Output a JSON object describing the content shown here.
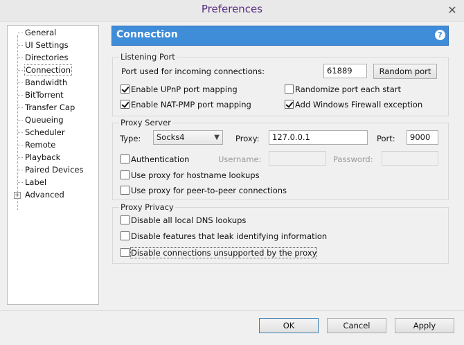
{
  "window": {
    "title": "Preferences",
    "close_glyph": "✕"
  },
  "sidebar": {
    "items": [
      {
        "label": "General"
      },
      {
        "label": "UI Settings"
      },
      {
        "label": "Directories"
      },
      {
        "label": "Connection"
      },
      {
        "label": "Bandwidth"
      },
      {
        "label": "BitTorrent"
      },
      {
        "label": "Transfer Cap"
      },
      {
        "label": "Queueing"
      },
      {
        "label": "Scheduler"
      },
      {
        "label": "Remote"
      },
      {
        "label": "Playback"
      },
      {
        "label": "Paired Devices"
      },
      {
        "label": "Label"
      },
      {
        "label": "Advanced"
      }
    ],
    "selected": "Connection",
    "expander_glyph": "+"
  },
  "header": {
    "title": "Connection",
    "help_glyph": "?"
  },
  "listening_port": {
    "group_label": "Listening Port",
    "port_label": "Port used for incoming connections:",
    "port_value": "61889",
    "random_port_button": "Random port",
    "upnp_label": "Enable UPnP port mapping",
    "upnp_checked": true,
    "randomize_label": "Randomize port each start",
    "randomize_checked": false,
    "natpmp_label": "Enable NAT-PMP port mapping",
    "natpmp_checked": true,
    "firewall_label": "Add Windows Firewall exception",
    "firewall_checked": true
  },
  "proxy_server": {
    "group_label": "Proxy Server",
    "type_label": "Type:",
    "type_value": "Socks4",
    "proxy_label": "Proxy:",
    "proxy_value": "127.0.0.1",
    "port_label": "Port:",
    "port_value": "9000",
    "auth_label": "Authentication",
    "auth_checked": false,
    "username_label": "Username:",
    "password_label": "Password:",
    "hostname_label": "Use proxy for hostname lookups",
    "hostname_checked": false,
    "p2p_label": "Use proxy for peer-to-peer connections",
    "p2p_checked": false
  },
  "proxy_privacy": {
    "group_label": "Proxy Privacy",
    "dns_label": "Disable all local DNS lookups",
    "dns_checked": false,
    "leak_label": "Disable features that leak identifying information",
    "leak_checked": false,
    "unsupported_label": "Disable connections unsupported by the proxy",
    "unsupported_checked": false
  },
  "footer": {
    "ok": "OK",
    "cancel": "Cancel",
    "apply": "Apply"
  }
}
